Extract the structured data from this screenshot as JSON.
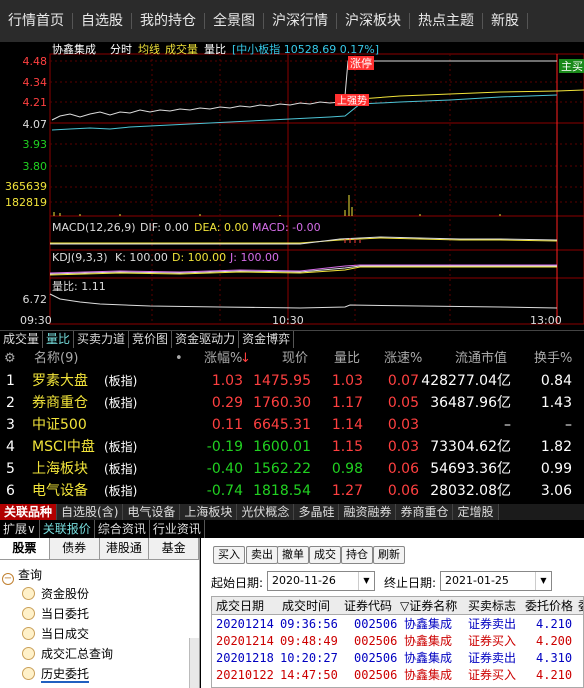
{
  "top_nav": [
    "行情首页",
    "自选股",
    "我的持仓",
    "全景图",
    "沪深行情",
    "沪深板块",
    "热点主题",
    "新股"
  ],
  "chart": {
    "stock_name": "协鑫集成",
    "mode_labels": [
      "分时",
      "均线",
      "成交量",
      "量比"
    ],
    "index_label": "[中小板指 10528.69 0.17%]",
    "price_ticks": [
      "4.48",
      "4.34",
      "4.21",
      "4.07",
      "3.93",
      "3.80"
    ],
    "volume_ticks": [
      "365639",
      "182819"
    ],
    "volume_ratio_tick": "6.72",
    "annotations": [
      "涨停",
      "上强势",
      "主买"
    ],
    "macd_label": "MACD(12,26,9)",
    "macd_dif": "DIF: 0.00",
    "macd_dea": "DEA: 0.00",
    "macd_macd": "MACD: -0.00",
    "kdj_label": "KDJ(9,3,3)",
    "kdj_k": "K: 100.00",
    "kdj_d": "D: 100.00",
    "kdj_j": "J: 100.00",
    "volume_ratio_label": "量比: 1.11",
    "time_ticks": [
      "09:30",
      "10:30",
      "13:00"
    ],
    "colors": {
      "price_line": "#ffffff",
      "avg_line": "#f1e33a",
      "limit_line": "#ff3030",
      "grid": "#8b0000"
    }
  },
  "chart_tabs": [
    "成交量",
    "量比",
    "买卖力道",
    "竞价图",
    "资金驱动力",
    "资金博弈"
  ],
  "table": {
    "headers": {
      "name": "名称(9)",
      "change_pct": "涨幅%",
      "price": "现价",
      "vol_ratio": "量比",
      "speed": "涨速%",
      "market_cap": "流通市值",
      "turnover": "换手%"
    },
    "rows": [
      {
        "no": "1",
        "name": "罗素大盘",
        "tag": "(板指)",
        "change_pct": "1.03",
        "price": "1475.95",
        "vol_ratio": "1.03",
        "speed": "0.07",
        "market_cap": "428277.04亿",
        "turnover": "0.84",
        "dir": "up"
      },
      {
        "no": "2",
        "name": "券商重仓",
        "tag": "(板指)",
        "change_pct": "0.29",
        "price": "1760.30",
        "vol_ratio": "1.17",
        "speed": "0.05",
        "market_cap": "36487.96亿",
        "turnover": "1.43",
        "dir": "up"
      },
      {
        "no": "3",
        "name": "中证500",
        "tag": "",
        "change_pct": "0.11",
        "price": "6645.31",
        "vol_ratio": "1.14",
        "speed": "0.03",
        "market_cap": "–",
        "turnover": "–",
        "dir": "up"
      },
      {
        "no": "4",
        "name": "MSCI中盘",
        "tag": "(板指)",
        "change_pct": "-0.19",
        "price": "1600.01",
        "vol_ratio": "1.15",
        "speed": "0.03",
        "market_cap": "73304.62亿",
        "turnover": "1.82",
        "dir": "down"
      },
      {
        "no": "5",
        "name": "上海板块",
        "tag": "(板指)",
        "change_pct": "-0.40",
        "price": "1562.22",
        "vol_ratio": "0.98",
        "speed": "0.06",
        "market_cap": "54693.36亿",
        "turnover": "0.99",
        "dir": "down"
      },
      {
        "no": "6",
        "name": "电气设备",
        "tag": "(板指)",
        "change_pct": "-0.74",
        "price": "1818.54",
        "vol_ratio": "1.27",
        "speed": "0.06",
        "market_cap": "28032.08亿",
        "turnover": "3.06",
        "dir": "down"
      }
    ]
  },
  "sector_tabs": [
    "关联品种",
    "自选股(含)",
    "电气设备",
    "上海板块",
    "光伏概念",
    "多晶硅",
    "融资融券",
    "券商重仓",
    "定增股"
  ],
  "sub_tabs": [
    "扩展∨",
    "关联报价",
    "综合资讯",
    "行业资讯"
  ],
  "account_tabs": [
    "股票",
    "债券",
    "港股通",
    "基金"
  ],
  "tree": {
    "root": "查询",
    "items": [
      "资金股份",
      "当日委托",
      "当日成交",
      "成交汇总查询",
      "历史委托"
    ]
  },
  "toolbar_buttons": [
    "买入",
    "卖出",
    "撤单",
    "成交",
    "持仓",
    "刷新"
  ],
  "date_filter": {
    "start_label": "起始日期:",
    "start_value": "2020-11-26",
    "end_label": "终止日期:",
    "end_value": "2021-01-25"
  },
  "orders": {
    "headers": [
      "成交日期",
      "成交时间",
      "证券代码",
      "▽证券名称",
      "买卖标志",
      "委托价格",
      "委"
    ],
    "rows": [
      {
        "date": "20201214",
        "time": "09:36:56",
        "code": "002506",
        "name": "协鑫集成",
        "side": "证券卖出",
        "price": "4.210",
        "type": "sell"
      },
      {
        "date": "20201214",
        "time": "09:48:49",
        "code": "002506",
        "name": "协鑫集成",
        "side": "证券买入",
        "price": "4.200",
        "type": "buy"
      },
      {
        "date": "20201218",
        "time": "10:20:27",
        "code": "002506",
        "name": "协鑫集成",
        "side": "证券卖出",
        "price": "4.310",
        "type": "sell"
      },
      {
        "date": "20210122",
        "time": "14:47:50",
        "code": "002506",
        "name": "协鑫集成",
        "side": "证券买入",
        "price": "4.210",
        "type": "buy"
      }
    ]
  }
}
